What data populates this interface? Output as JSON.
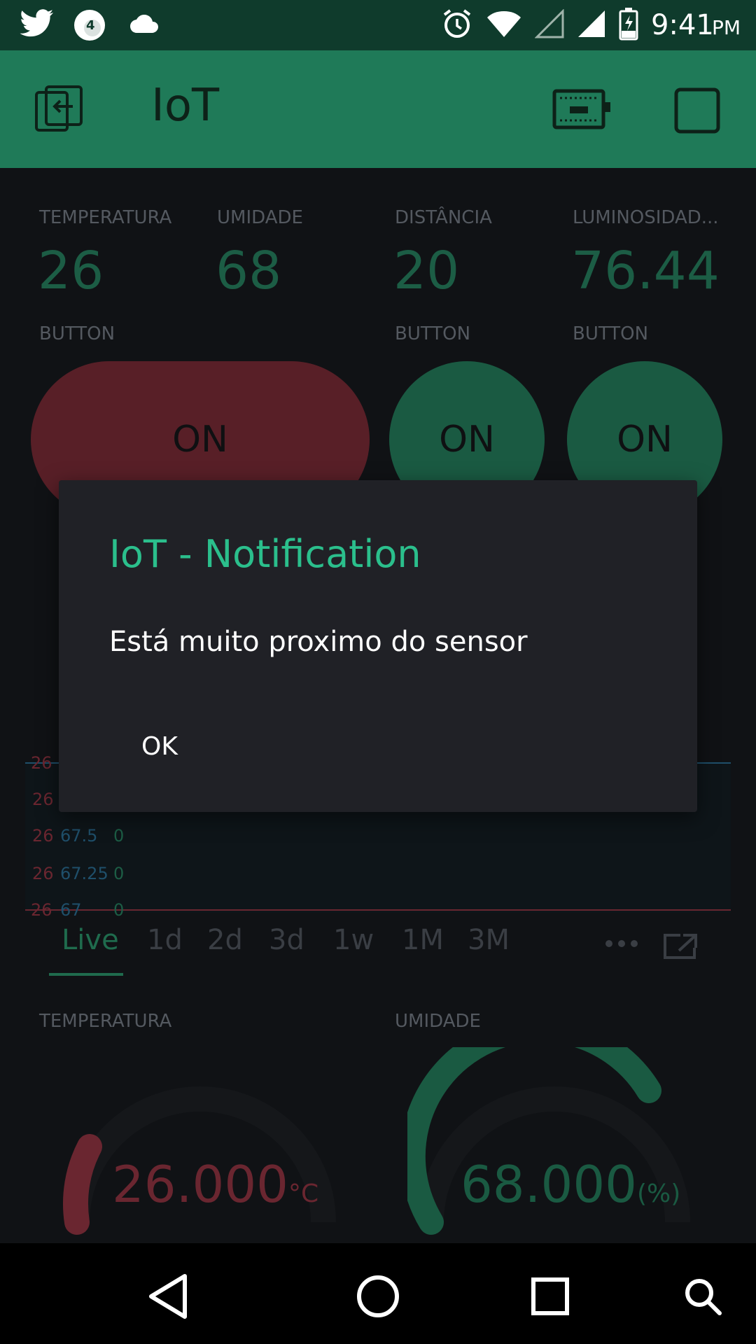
{
  "status_bar": {
    "time": "9:41",
    "ampm": "PM",
    "left_icons": [
      "twitter-icon",
      "notification-count-icon",
      "cloud-icon"
    ],
    "notification_count": "4",
    "right_icons": [
      "alarm-icon",
      "wifi-icon",
      "signal-empty-icon",
      "signal-icon",
      "battery-charging-icon"
    ]
  },
  "app_bar": {
    "title": "IoT",
    "icons": [
      "exit-icon",
      "device-icon",
      "square-icon"
    ]
  },
  "widgets": {
    "values": [
      {
        "label": "TEMPERATURA",
        "value": "26"
      },
      {
        "label": "UMIDADE",
        "value": "68"
      },
      {
        "label": "DISTÂNCIA",
        "value": "20"
      },
      {
        "label": "LUMINOSIDAD...",
        "value": "76.44"
      }
    ],
    "buttons": [
      {
        "label": "BUTTON",
        "state": "ON"
      },
      {
        "label": "BUTTON",
        "state": "ON"
      },
      {
        "label": "BUTTON",
        "state": "ON"
      }
    ]
  },
  "chart": {
    "y_ticks_red": [
      "26",
      "26",
      "26",
      "26",
      "26"
    ],
    "y_ticks_blue": [
      "67.5",
      "67.25",
      "67"
    ],
    "y_ticks_green": [
      "0",
      "0",
      "0"
    ],
    "tabs": [
      "Live",
      "1d",
      "2d",
      "3d",
      "1w",
      "1M",
      "3M"
    ],
    "selected_tab": "Live"
  },
  "gauges": [
    {
      "label": "TEMPERATURA",
      "value": "26.000",
      "unit": "°C",
      "fraction": 0.2,
      "color": "#6a2630"
    },
    {
      "label": "UMIDADE",
      "value": "68.000",
      "unit": "(%)",
      "fraction": 0.68,
      "color": "#1a5a42"
    }
  ],
  "dialog": {
    "title": "IoT - Notification",
    "message": "Está muito proximo do sensor",
    "ok_label": "OK"
  },
  "colors": {
    "status_bar": "#0f3b2c",
    "app_bar": "#1f7a58",
    "accent": "#2bbf8c",
    "dialog_bg": "#202126"
  }
}
